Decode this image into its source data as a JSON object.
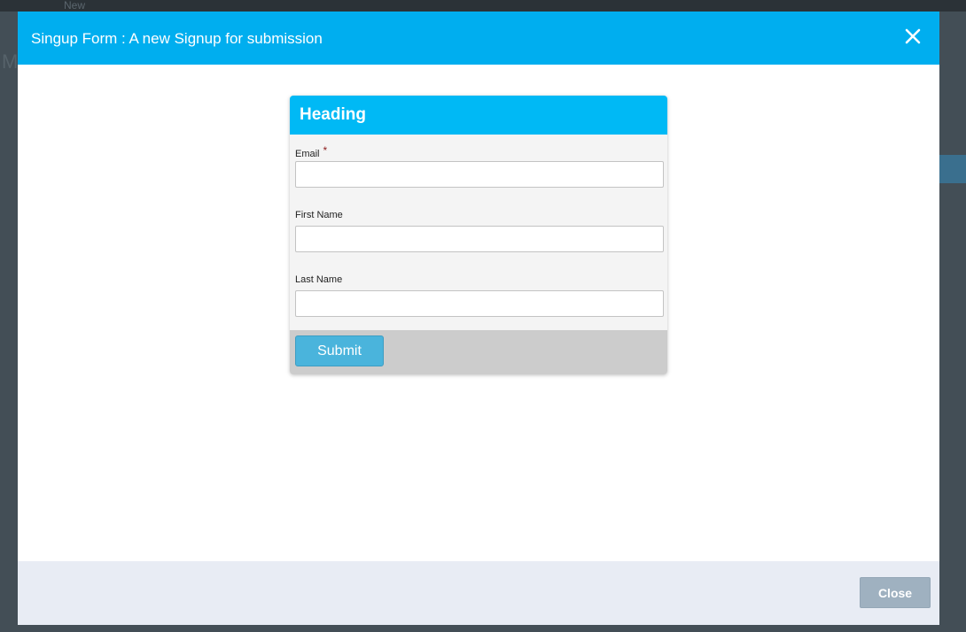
{
  "background": {
    "toolbar_new_label": "New",
    "page_letter": "M"
  },
  "modal": {
    "title": "Singup Form : A new Signup for submission",
    "close_icon": "close-x-icon",
    "footer": {
      "close_label": "Close"
    }
  },
  "form": {
    "heading": "Heading",
    "fields": [
      {
        "label": "Email",
        "required": true,
        "value": "",
        "placeholder": ""
      },
      {
        "label": "First Name",
        "required": false,
        "value": "",
        "placeholder": ""
      },
      {
        "label": "Last Name",
        "required": false,
        "value": "",
        "placeholder": ""
      }
    ],
    "required_marker": "*",
    "submit_label": "Submit"
  },
  "colors": {
    "header": "#00aeef",
    "form_heading": "#00b9f5",
    "submit": "#4ab4dc",
    "close_button": "#9fb1c0",
    "footer": "#e8ecf4"
  }
}
